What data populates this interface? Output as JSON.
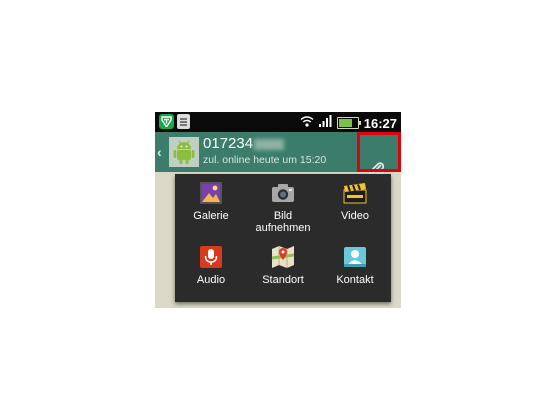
{
  "status_bar": {
    "time": "16:27",
    "battery_level": 0.75,
    "icons": [
      "t-app-icon",
      "clipboard-icon",
      "wifi-icon",
      "signal-bars-icon",
      "battery-icon"
    ]
  },
  "chat_header": {
    "contact_name_visible": "017234",
    "contact_status": "zul. online heute um 15:20",
    "avatar_icon": "android-robot-icon",
    "attach_icon": "paperclip-icon"
  },
  "attachment_menu": {
    "items": [
      {
        "label": "Galerie",
        "icon": "gallery-icon"
      },
      {
        "label": "Bild\naufnehmen",
        "icon": "camera-icon"
      },
      {
        "label": "Video",
        "icon": "clapperboard-icon"
      },
      {
        "label": "Audio",
        "icon": "microphone-icon"
      },
      {
        "label": "Standort",
        "icon": "map-pin-icon"
      },
      {
        "label": "Kontakt",
        "icon": "contact-card-icon"
      }
    ]
  },
  "colors": {
    "action_bar": "#3b7c6b",
    "highlight_box": "#e0000e",
    "menu_background": "#2b2b2b"
  }
}
